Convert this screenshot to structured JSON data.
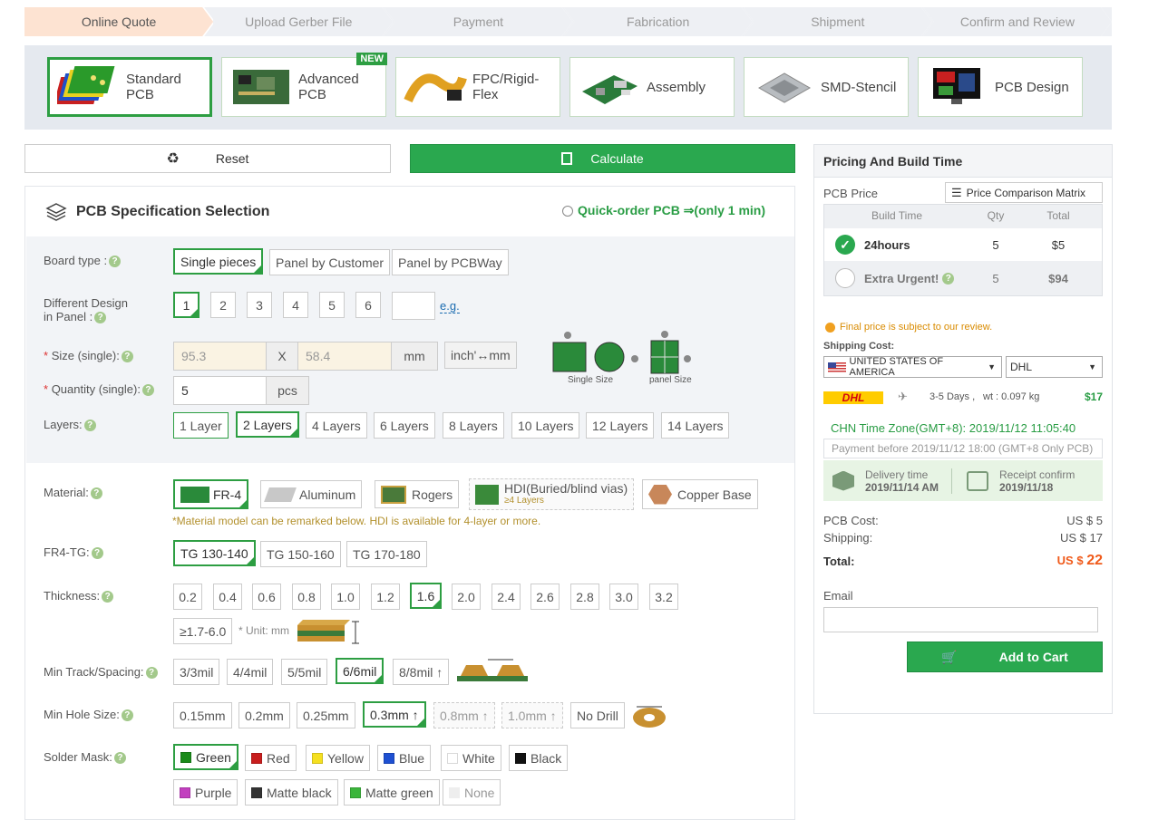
{
  "steps": [
    "Online Quote",
    "Upload Gerber File",
    "Payment",
    "Fabrication",
    "Shipment",
    "Confirm and Review"
  ],
  "categories": [
    {
      "label": "Standard PCB",
      "icon": "standard-pcb-image"
    },
    {
      "label": "Advanced PCB",
      "icon": "advanced-pcb-image",
      "badge": "NEW"
    },
    {
      "label": "FPC/Rigid-Flex",
      "icon": "fpc-image"
    },
    {
      "label": "Assembly",
      "icon": "assembly-image"
    },
    {
      "label": "SMD-Stencil",
      "icon": "stencil-image"
    },
    {
      "label": "PCB Design",
      "icon": "pcb-design-image"
    }
  ],
  "toolbar": {
    "reset": "Reset",
    "calculate": "Calculate"
  },
  "spec": {
    "title": "PCB Specification Selection",
    "quick": "Quick-order PCB ⇒(only 1 min)",
    "board_type": {
      "label": "Board type :",
      "options": [
        "Single pieces",
        "Panel by Customer",
        "Panel by PCBWay"
      ]
    },
    "design": {
      "label1": "Different Design",
      "label2": "in Panel :",
      "options": [
        "1",
        "2",
        "3",
        "4",
        "5",
        "6"
      ],
      "eg": "e.g."
    },
    "size": {
      "label": "Size (single):",
      "star": "*",
      "w": "95.3",
      "x": "X",
      "h": "58.4",
      "unit": "mm",
      "toggle": "inch'↔mm",
      "single_caption": "Single Size",
      "panel_caption": "panel Size"
    },
    "quantity": {
      "label": "Quantity (single):",
      "star": "*",
      "value": "5",
      "unit": "pcs"
    },
    "layers": {
      "label": "Layers:",
      "options": [
        "1 Layer",
        "2 Layers",
        "4 Layers",
        "6 Layers",
        "8 Layers",
        "10 Layers",
        "12 Layers",
        "14 Layers"
      ]
    },
    "material": {
      "label": "Material:",
      "options": [
        "FR-4",
        "Aluminum",
        "Rogers",
        "HDI(Buried/blind vias)",
        "Copper Base"
      ],
      "hdi_sub": "≥4 Layers",
      "note": "*Material model can be remarked below. HDI is available for 4-layer or more."
    },
    "tg": {
      "label": "FR4-TG:",
      "options": [
        "TG 130-140",
        "TG 150-160",
        "TG 170-180"
      ]
    },
    "thickness": {
      "label": "Thickness:",
      "options": [
        "0.2",
        "0.4",
        "0.6",
        "0.8",
        "1.0",
        "1.2",
        "1.6",
        "2.0",
        "2.4",
        "2.6",
        "2.8",
        "3.0",
        "3.2"
      ],
      "extra": "≥1.7-6.0",
      "unit_note": "* Unit: mm"
    },
    "track": {
      "label": "Min Track/Spacing:",
      "options": [
        "3/3mil",
        "4/4mil",
        "5/5mil",
        "6/6mil",
        "8/8mil ↑"
      ]
    },
    "hole": {
      "label": "Min Hole Size:",
      "options": [
        "0.15mm",
        "0.2mm",
        "0.25mm",
        "0.3mm ↑",
        "0.8mm ↑",
        "1.0mm ↑",
        "No Drill"
      ]
    },
    "mask": {
      "label": "Solder Mask:",
      "options": [
        "Green",
        "Red",
        "Yellow",
        "Blue",
        "White",
        "Black",
        "Purple",
        "Matte black",
        "Matte green",
        "None"
      ]
    }
  },
  "colors": {
    "green": "#1a8a1a",
    "red": "#c81e1e",
    "yellow": "#f5e020",
    "blue": "#1e50d2",
    "white": "#ffffff",
    "black": "#111111",
    "purple": "#c23fbf",
    "matte_black": "#333333",
    "matte_green": "#3bb53b",
    "none": "#eeeeee"
  },
  "pricing": {
    "title": "Pricing And Build Time",
    "pcb_price": "PCB Price",
    "matrix": "Price Comparison Matrix",
    "cols": [
      "Build Time",
      "Qty",
      "Total"
    ],
    "rows": [
      {
        "time": "24hours",
        "qty": "5",
        "total": "$5"
      },
      {
        "time": "Extra Urgent!",
        "qty": "5",
        "total": "$94"
      }
    ],
    "note": "Final price is subject to our review.",
    "shipping_label": "Shipping Cost:",
    "country": "UNITED STATES OF AMERICA",
    "carrier": "DHL",
    "dhl_logo": "DHL",
    "days": "3-5 Days ,",
    "weight": "wt : 0.097 kg",
    "ship_price": "$17",
    "timezone": "CHN Time Zone(GMT+8): 2019/11/12 11:05:40",
    "pay_before": "Payment before 2019/11/12 18:00 (GMT+8 Only PCB)",
    "delivery_label": "Delivery time",
    "delivery_date": "2019/11/14 AM",
    "receipt_label": "Receipt confirm",
    "receipt_date": "2019/11/18",
    "pcb_cost_label": "PCB Cost:",
    "pcb_cost": "US $ 5",
    "shipping_cost_label": "Shipping:",
    "shipping_cost": "US $ 17",
    "total_label": "Total:",
    "total_cur": "US $",
    "total": "22",
    "email_label": "Email",
    "add_to_cart": "Add to Cart"
  }
}
